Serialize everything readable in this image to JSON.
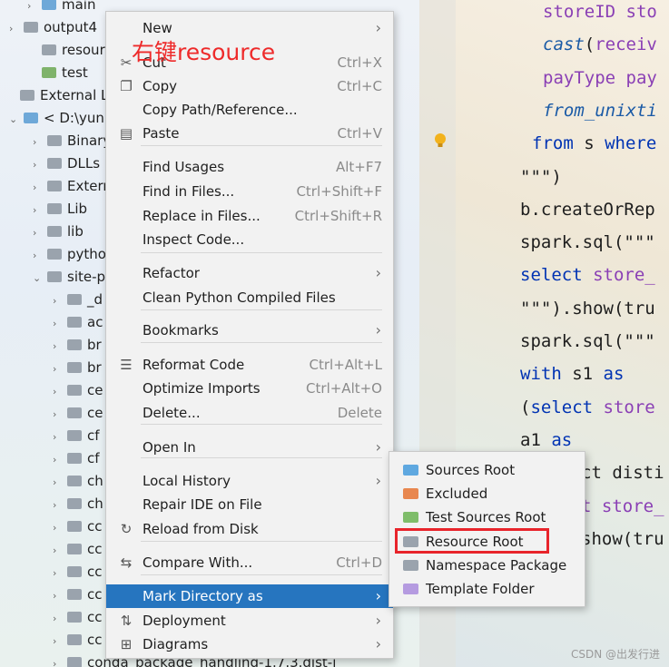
{
  "tree": {
    "rows": [
      {
        "label": "main",
        "folder": "blue",
        "arrow": "›"
      },
      {
        "label": "output4",
        "folder": "grey",
        "arrow": "›"
      },
      {
        "label": "resource",
        "folder": "grey",
        "arrow": ""
      },
      {
        "label": "test",
        "folder": "green",
        "arrow": ""
      },
      {
        "label": "External Lib",
        "folder": "grey",
        "arrow": ""
      },
      {
        "label": "< D:\\yun",
        "folder": "blue",
        "arrow": "⌄"
      },
      {
        "label": "Binary",
        "folder": "grey",
        "arrow": "›"
      },
      {
        "label": "DLLs",
        "folder": "grey",
        "arrow": "›"
      },
      {
        "label": "Extern",
        "folder": "grey",
        "arrow": "›"
      },
      {
        "label": "Lib",
        "folder": "grey",
        "arrow": "›"
      },
      {
        "label": "lib",
        "folder": "grey",
        "arrow": "›"
      },
      {
        "label": "pytho",
        "folder": "grey",
        "arrow": "›"
      },
      {
        "label": "site-p",
        "folder": "grey",
        "arrow": "⌄"
      },
      {
        "label": "_d",
        "folder": "grey",
        "arrow": "›"
      },
      {
        "label": "ac",
        "folder": "grey",
        "arrow": "›"
      },
      {
        "label": "br",
        "folder": "grey",
        "arrow": "›"
      },
      {
        "label": "br",
        "folder": "grey",
        "arrow": "›"
      },
      {
        "label": "ce",
        "folder": "grey",
        "arrow": "›"
      },
      {
        "label": "ce",
        "folder": "grey",
        "arrow": "›"
      },
      {
        "label": "cf",
        "folder": "grey",
        "arrow": "›"
      },
      {
        "label": "cf",
        "folder": "grey",
        "arrow": "›"
      },
      {
        "label": "ch",
        "folder": "grey",
        "arrow": "›"
      },
      {
        "label": "ch",
        "folder": "grey",
        "arrow": "›"
      },
      {
        "label": "cc",
        "folder": "grey",
        "arrow": "›"
      },
      {
        "label": "cc",
        "folder": "grey",
        "arrow": "›"
      },
      {
        "label": "cc",
        "folder": "grey",
        "arrow": "›"
      },
      {
        "label": "cc",
        "folder": "grey",
        "arrow": "›"
      },
      {
        "label": "cc",
        "folder": "grey",
        "arrow": "›"
      },
      {
        "label": "cc",
        "folder": "grey",
        "arrow": "›"
      },
      {
        "label": "conda_package_handling-1.7.3.dist-i",
        "folder": "grey",
        "arrow": "›"
      }
    ]
  },
  "editor": {
    "lines": [
      {
        "parts": [
          {
            "t": "storeID sto",
            "c": "pu"
          }
        ]
      },
      {
        "parts": [
          {
            "t": "cast",
            "c": "it"
          },
          {
            "t": "(",
            "c": ""
          },
          {
            "t": "receiv",
            "c": "pu"
          }
        ]
      },
      {
        "parts": [
          {
            "t": "payType pay",
            "c": "pu"
          }
        ]
      },
      {
        "parts": [
          {
            "t": "from_unixti",
            "c": "it"
          }
        ]
      },
      {
        "parts": [
          {
            "t": "from",
            "c": "kw"
          },
          {
            "t": " s ",
            "c": ""
          },
          {
            "t": "where",
            "c": "kw"
          }
        ]
      },
      {
        "parts": [
          {
            "t": "\"\"\")",
            "c": ""
          }
        ]
      },
      {
        "parts": [
          {
            "t": "b.createOrRep",
            "c": ""
          }
        ]
      },
      {
        "parts": [
          {
            "t": "spark.sql(\"\"\"",
            "c": ""
          }
        ]
      },
      {
        "parts": [
          {
            "t": "select",
            "c": "kw"
          },
          {
            "t": " ",
            "c": ""
          },
          {
            "t": "store_",
            "c": "pu"
          }
        ]
      },
      {
        "parts": [
          {
            "t": "\"\"\").show(tru",
            "c": ""
          }
        ]
      },
      {
        "parts": [
          {
            "t": "spark.sql(\"\"\"",
            "c": ""
          }
        ]
      },
      {
        "parts": [
          {
            "t": "with",
            "c": "kw"
          },
          {
            "t": " s1 ",
            "c": ""
          },
          {
            "t": "as",
            "c": "kw"
          }
        ]
      },
      {
        "parts": [
          {
            "t": "(",
            "c": ""
          },
          {
            "t": "select",
            "c": "kw"
          },
          {
            "t": " ",
            "c": ""
          },
          {
            "t": "store",
            "c": "pu"
          }
        ]
      },
      {
        "parts": [
          {
            "t": "a1 ",
            "c": ""
          },
          {
            "t": "as",
            "c": "kw"
          }
        ]
      },
      {
        "parts": [
          {
            "t": "ct disti",
            "c": ""
          }
        ]
      },
      {
        "parts": [
          {
            "t": "t store_",
            "c": "pu"
          }
        ]
      },
      {
        "parts": [
          {
            "t": "show(tru",
            "c": ""
          }
        ]
      }
    ]
  },
  "annotation": "右键resource",
  "context_menu": {
    "items": [
      {
        "label": "New",
        "shortcut": "",
        "submenu": true,
        "icon": ""
      },
      {
        "label": "Cut",
        "shortcut": "Ctrl+X",
        "submenu": false,
        "icon": "✂"
      },
      {
        "label": "Copy",
        "shortcut": "Ctrl+C",
        "submenu": false,
        "icon": "❐"
      },
      {
        "label": "Copy Path/Reference...",
        "shortcut": "",
        "submenu": false,
        "icon": ""
      },
      {
        "label": "Paste",
        "shortcut": "Ctrl+V",
        "submenu": false,
        "icon": "▤"
      },
      {
        "label": "Find Usages",
        "shortcut": "Alt+F7",
        "submenu": false,
        "icon": ""
      },
      {
        "label": "Find in Files...",
        "shortcut": "Ctrl+Shift+F",
        "submenu": false,
        "icon": ""
      },
      {
        "label": "Replace in Files...",
        "shortcut": "Ctrl+Shift+R",
        "submenu": false,
        "icon": ""
      },
      {
        "label": "Inspect Code...",
        "shortcut": "",
        "submenu": false,
        "icon": ""
      },
      {
        "label": "Refactor",
        "shortcut": "",
        "submenu": true,
        "icon": ""
      },
      {
        "label": "Clean Python Compiled Files",
        "shortcut": "",
        "submenu": false,
        "icon": ""
      },
      {
        "label": "Bookmarks",
        "shortcut": "",
        "submenu": true,
        "icon": ""
      },
      {
        "label": "Reformat Code",
        "shortcut": "Ctrl+Alt+L",
        "submenu": false,
        "icon": "☰"
      },
      {
        "label": "Optimize Imports",
        "shortcut": "Ctrl+Alt+O",
        "submenu": false,
        "icon": ""
      },
      {
        "label": "Delete...",
        "shortcut": "Delete",
        "submenu": false,
        "icon": ""
      },
      {
        "label": "Open In",
        "shortcut": "",
        "submenu": true,
        "icon": ""
      },
      {
        "label": "Local History",
        "shortcut": "",
        "submenu": true,
        "icon": ""
      },
      {
        "label": "Repair IDE on File",
        "shortcut": "",
        "submenu": false,
        "icon": ""
      },
      {
        "label": "Reload from Disk",
        "shortcut": "",
        "submenu": false,
        "icon": "↻"
      },
      {
        "label": "Compare With...",
        "shortcut": "Ctrl+D",
        "submenu": false,
        "icon": "⇆"
      },
      {
        "label": "Mark Directory as",
        "shortcut": "",
        "submenu": true,
        "icon": "",
        "selected": true
      },
      {
        "label": "Deployment",
        "shortcut": "",
        "submenu": true,
        "icon": "⇅"
      },
      {
        "label": "Diagrams",
        "shortcut": "",
        "submenu": true,
        "icon": "⊞"
      }
    ]
  },
  "submenu": {
    "items": [
      {
        "label": "Sources Root",
        "color": "#5fa8e0"
      },
      {
        "label": "Excluded",
        "color": "#e8874f"
      },
      {
        "label": "Test Sources Root",
        "color": "#7fbd6a"
      },
      {
        "label": "Resource Root",
        "color": "#9aa3ad",
        "highlighted": true
      },
      {
        "label": "Namespace Package",
        "color": "#9aa3ad"
      },
      {
        "label": "Template Folder",
        "color": "#b59be0"
      }
    ]
  },
  "watermark": "CSDN @出发行进"
}
